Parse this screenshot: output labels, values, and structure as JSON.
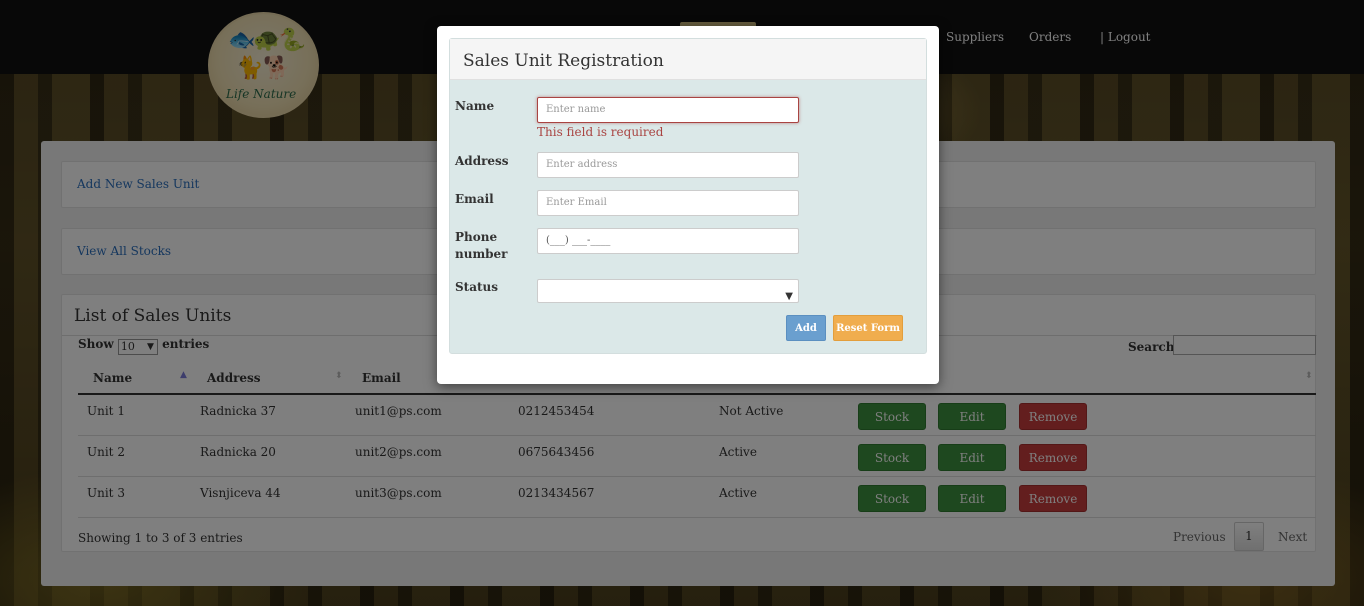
{
  "logo": {
    "text": "Life Nature"
  },
  "nav": {
    "suppliers": "Suppliers",
    "orders": "Orders",
    "logout": "| Logout"
  },
  "actions": {
    "add_new": "Add New Sales Unit",
    "view_stocks": "View All Stocks"
  },
  "list": {
    "title": "List of Sales Units",
    "show_label": "Show",
    "entries_value": "10",
    "entries_label": "entries",
    "search_label": "Search:",
    "columns": [
      "Name",
      "Address",
      "Email"
    ],
    "rows": [
      {
        "name": "Unit 1",
        "address": "Radnicka 37",
        "email": "unit1@ps.com",
        "phone": "0212453454",
        "status": "Not Active"
      },
      {
        "name": "Unit 2",
        "address": "Radnicka 20",
        "email": "unit2@ps.com",
        "phone": "0675643456",
        "status": "Active"
      },
      {
        "name": "Unit 3",
        "address": "Visnjiceva 44",
        "email": "unit3@ps.com",
        "phone": "0213434567",
        "status": "Active"
      }
    ],
    "row_buttons": {
      "stock": "Stock",
      "edit": "Edit",
      "remove": "Remove"
    },
    "info": "Showing 1 to 3 of 3 entries",
    "pagination": {
      "previous": "Previous",
      "current": "1",
      "next": "Next"
    }
  },
  "modal": {
    "title": "Sales Unit Registration",
    "fields": {
      "name": {
        "label": "Name",
        "placeholder": "Enter name",
        "error": "This field is required"
      },
      "address": {
        "label": "Address",
        "placeholder": "Enter address"
      },
      "email": {
        "label": "Email",
        "placeholder": "Enter Email"
      },
      "phone": {
        "label_line1": "Phone",
        "label_line2": "number",
        "placeholder": "(___) ___-____"
      },
      "status": {
        "label": "Status",
        "value": ""
      }
    },
    "add_button": "Add",
    "reset_button": "Reset Form"
  }
}
